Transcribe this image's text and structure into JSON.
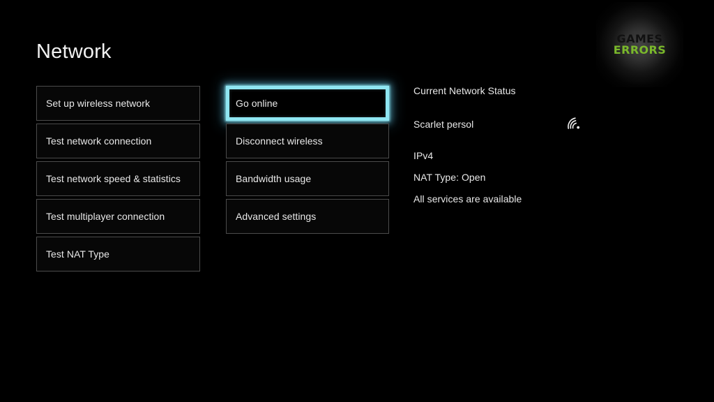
{
  "page": {
    "title": "Network",
    "background_color": "#000000",
    "text_color": "#e9e9e9"
  },
  "menu_primary": {
    "items": [
      {
        "label": "Set up wireless network"
      },
      {
        "label": "Test network connection"
      },
      {
        "label": "Test network speed & statistics"
      },
      {
        "label": "Test multiplayer connection"
      },
      {
        "label": "Test NAT Type"
      }
    ]
  },
  "menu_secondary": {
    "selected_index": 0,
    "highlight_color": "#8fe6f2",
    "items": [
      {
        "label": "Go online",
        "selected": true
      },
      {
        "label": "Disconnect wireless",
        "selected": false
      },
      {
        "label": "Bandwidth usage",
        "selected": false
      },
      {
        "label": "Advanced settings",
        "selected": false
      }
    ]
  },
  "status": {
    "heading": "Current Network Status",
    "ssid": "Scarlet persol",
    "wifi_icon": "wifi-signal-icon",
    "ip_version": "IPv4",
    "nat_type": "NAT Type: Open",
    "services": "All services are available"
  },
  "watermark": {
    "line1": "GAMES",
    "line2": "ERRORS",
    "line1_color": "#111111",
    "line2_color": "#7ab82b"
  }
}
